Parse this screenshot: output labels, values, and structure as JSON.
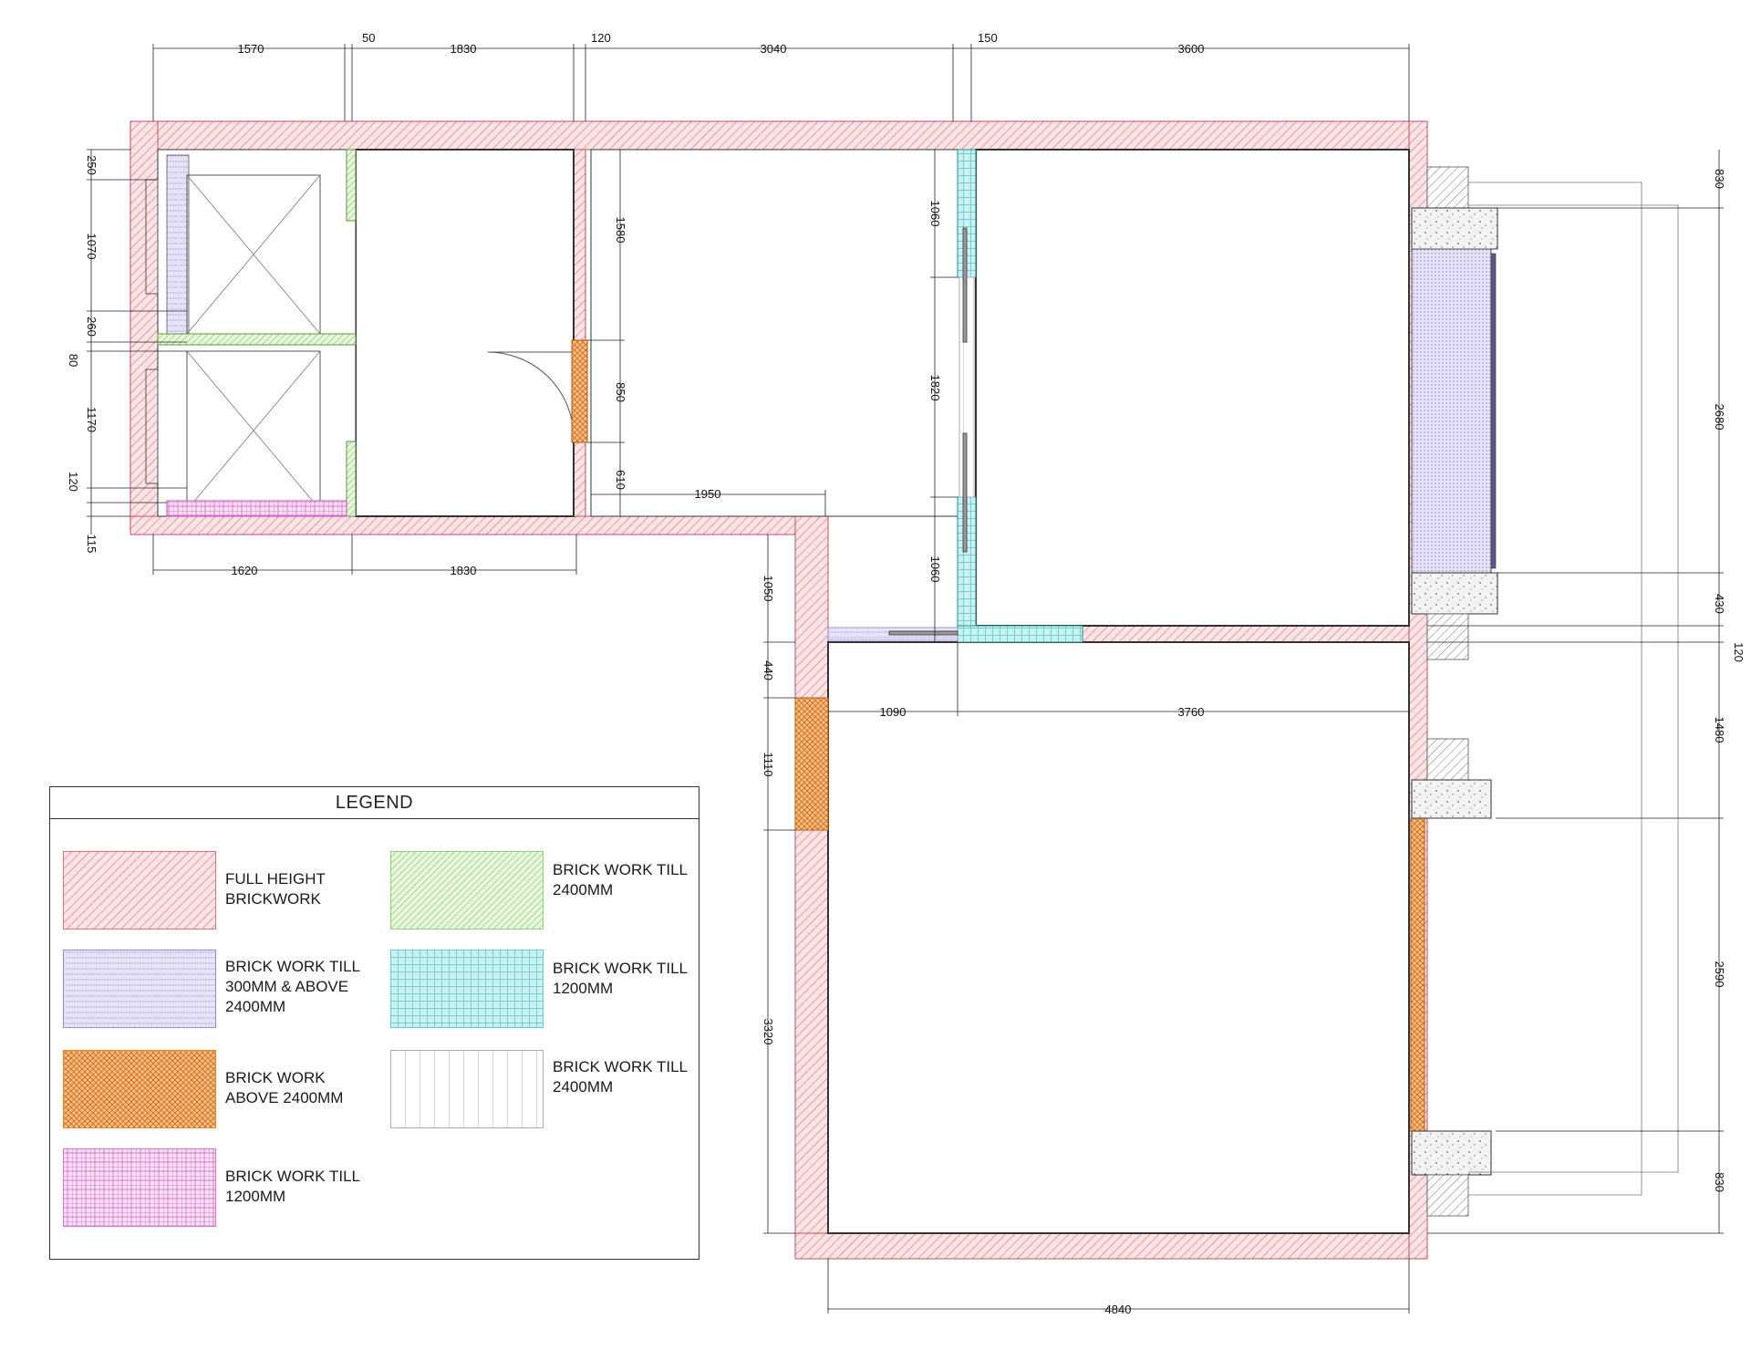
{
  "dimensions": {
    "top": [
      "1570",
      "50",
      "1830",
      "120",
      "3040",
      "150",
      "3600"
    ],
    "left": [
      "250",
      "1070",
      "260",
      "80",
      "1170",
      "120",
      "115"
    ],
    "bottom_left": [
      "1620",
      "1830"
    ],
    "inner_col": [
      "1580",
      "850",
      "610"
    ],
    "mid_col": [
      "1060",
      "1820",
      "1060"
    ],
    "corridor": "1950",
    "lower_left": [
      "1050",
      "440",
      "1110",
      "3320"
    ],
    "lower_horiz": [
      "1090",
      "3760"
    ],
    "right": [
      "830",
      "2680",
      "430",
      "120",
      "1480",
      "2590",
      "830"
    ],
    "bottom": "4840"
  },
  "legend": {
    "title": "LEGEND",
    "items": [
      {
        "lines": [
          "FULL HEIGHT",
          "BRICKWORK"
        ],
        "color": "#e0707a"
      },
      {
        "lines": [
          "BRICK WORK TILL",
          "300MM & ABOVE",
          "2400MM"
        ],
        "color": "#9a8ad6"
      },
      {
        "lines": [
          "BRICK WORK",
          "ABOVE 2400MM"
        ],
        "color": "#e8842a"
      },
      {
        "lines": [
          "BRICK WORK TILL",
          "1200MM"
        ],
        "color": "#e070d0"
      },
      {
        "lines": [
          "BRICK WORK TILL",
          "2400MM"
        ],
        "color": "#8fd07a"
      },
      {
        "lines": [
          "BRICK WORK TILL",
          "1200MM"
        ],
        "color": "#5ccfcf"
      },
      {
        "lines": [
          "BRICK WORK TILL",
          "2400MM"
        ],
        "color": "#a8a8c8"
      }
    ]
  }
}
